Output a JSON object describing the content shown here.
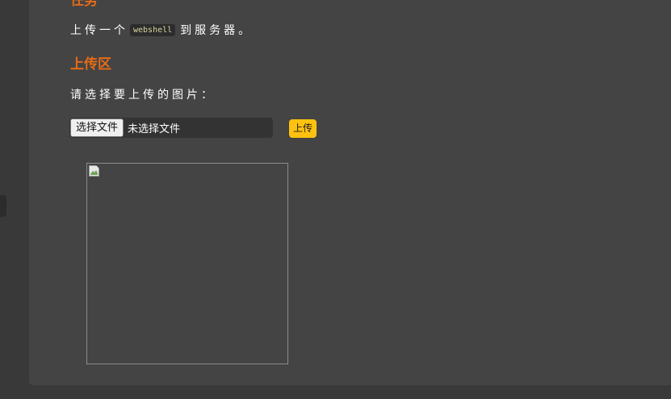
{
  "task": {
    "heading": "任务",
    "text_before": "上传一个",
    "code": "webshell",
    "text_after": "到服务器。"
  },
  "upload_section": {
    "heading": "上传区",
    "prompt": "请选择要上传的图片：",
    "file_button_label": "选择文件",
    "file_status": "未选择文件",
    "submit_label": "上传"
  },
  "colors": {
    "accent": "#e76b16",
    "button": "#ffc20f",
    "panel": "#444444",
    "background": "#393939"
  },
  "preview": {
    "icon": "broken-image-icon"
  }
}
